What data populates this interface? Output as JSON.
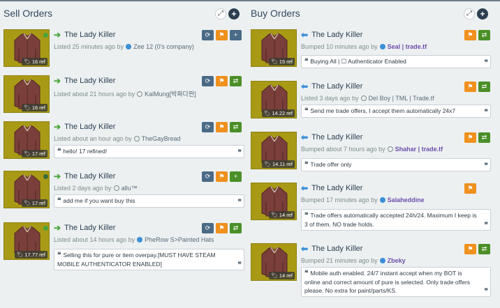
{
  "sell": {
    "title": "Sell Orders",
    "header_icons": [
      "expand-icon",
      "plus-icon"
    ],
    "listings": [
      {
        "name": "The Lady Killer",
        "time": "Listed 25 minutes ago by",
        "user": "Zee 12 (0's company)",
        "status": "online",
        "price": "16 ref",
        "buttons": [
          "refresh",
          "flag",
          "plus"
        ],
        "comment": ""
      },
      {
        "name": "The Lady Killer",
        "time": "Listed about 21 hours ago by",
        "user": "KalMung[박짜다판]",
        "status": "offline",
        "price": "16 ref",
        "buttons": [
          "refresh",
          "flag",
          "exchange"
        ],
        "comment": ""
      },
      {
        "name": "The Lady Killer",
        "time": "Listed about an hour ago by",
        "user": "TheGayBread",
        "status": "offline",
        "price": "17 ref",
        "buttons": [
          "refresh",
          "flag",
          "exchange"
        ],
        "comment": "hello! 17 refined!"
      },
      {
        "name": "The Lady Killer",
        "time": "Listed 2 days ago by",
        "user": "allu™",
        "status": "offline",
        "price": "17 ref",
        "buttons": [
          "refresh",
          "flag",
          "plus"
        ],
        "comment": "add me if you want buy this"
      },
      {
        "name": "The Lady Killer",
        "time": "Listed about 14 hours ago by",
        "user": "PheRow S>Painted Hats",
        "status": "online",
        "price": "17.77 ref",
        "buttons": [
          "refresh",
          "flag",
          "exchange"
        ],
        "comment": "Selling this for pure or item overpay.[MUST HAVE STEAM MOBILE AUTHENTICATOR ENABLED]"
      }
    ]
  },
  "buy": {
    "title": "Buy Orders",
    "header_icons": [
      "expand-icon",
      "plus-icon"
    ],
    "listings": [
      {
        "name": "The Lady Killer",
        "time": "Bumped 10 minutes ago by",
        "user": "Seal | trade.tf",
        "status": "online",
        "price": "15 ref",
        "buttons": [
          "flag",
          "exchange"
        ],
        "comment": "Buying All | ☐ Authenticator Enabled"
      },
      {
        "name": "The Lady Killer",
        "time": "Listed 3 days ago by",
        "user": "Del Boy | TML | Trade.tf",
        "status": "offline",
        "price": "14.22 ref",
        "buttons": [
          "flag",
          "exchange"
        ],
        "comment": "Send me trade offers, I accept them automatically 24x7"
      },
      {
        "name": "The Lady Killer",
        "time": "Bumped about 7 hours ago by",
        "user": " Shahar | trade.tf",
        "status": "offline",
        "price": "14.11 ref",
        "buttons": [
          "flag",
          "exchange"
        ],
        "comment": "Trade offer only"
      },
      {
        "name": "The Lady Killer",
        "time": "Bumped 17 minutes ago by",
        "user": "Salaheddine",
        "status": "online",
        "price": "14 ref",
        "buttons": [
          "flag"
        ],
        "comment": "Trade offers automatically accepted 24h/24. Maximum I keep is 3 of them. NO trade holds."
      },
      {
        "name": "The Lady Killer",
        "time": "Bumped 21 minutes ago by",
        "user": "Zbeky",
        "status": "online",
        "price": "14 ref",
        "buttons": [
          "flag",
          "exchange"
        ],
        "comment": "Mobile auth enabled. 24/7 instant accept when my BOT is online and correct amount of pure is selected. Only trade offers please. No extra for paint/parts/KS."
      }
    ]
  },
  "colors": {
    "item_bg": "#a99a16",
    "refresh": "#4a6a86",
    "flag": "#f0901d",
    "trade": "#4b8f27",
    "sell_arrow": "#4aa53c",
    "buy_arrow": "#3b8fd6"
  }
}
